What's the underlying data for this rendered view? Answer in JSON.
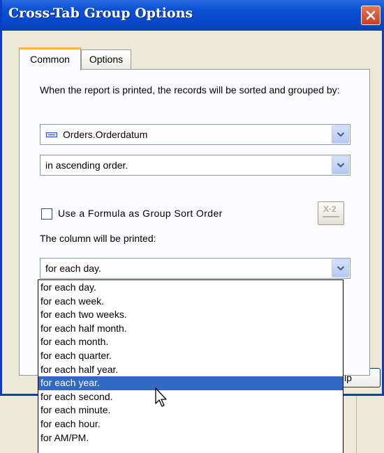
{
  "dialog": {
    "title": "Cross-Tab Group Options"
  },
  "tabs": [
    {
      "label": "Common",
      "active": true
    },
    {
      "label": "Options",
      "active": false
    }
  ],
  "intro_text": "When the report is printed, the records will be sorted and grouped by:",
  "sort_field": {
    "value": "Orders.Orderdatum",
    "icon": "database-field-icon"
  },
  "sort_order": {
    "value": "in ascending order."
  },
  "formula_checkbox": {
    "label": "Use a Formula as Group Sort Order",
    "checked": false
  },
  "formula_button": {
    "icon": "formula-icon",
    "glyph": "X·2"
  },
  "print_label": "The column will be printed:",
  "print_interval": {
    "value": "for each day.",
    "options": [
      "for each day.",
      "for each week.",
      "for each two weeks.",
      "for each half month.",
      "for each month.",
      "for each quarter.",
      "for each half year.",
      "for each year.",
      "for each second.",
      "for each minute.",
      "for each hour.",
      "for AM/PM."
    ],
    "highlighted": "for each year."
  },
  "help_button": {
    "partial_label": "lp"
  },
  "colors": {
    "titlebar": "#0a52d6",
    "dialog_bg": "#ece9d8",
    "selection": "#316ac5",
    "close_button": "#d4502a",
    "tab_highlight": "#f2b744"
  }
}
